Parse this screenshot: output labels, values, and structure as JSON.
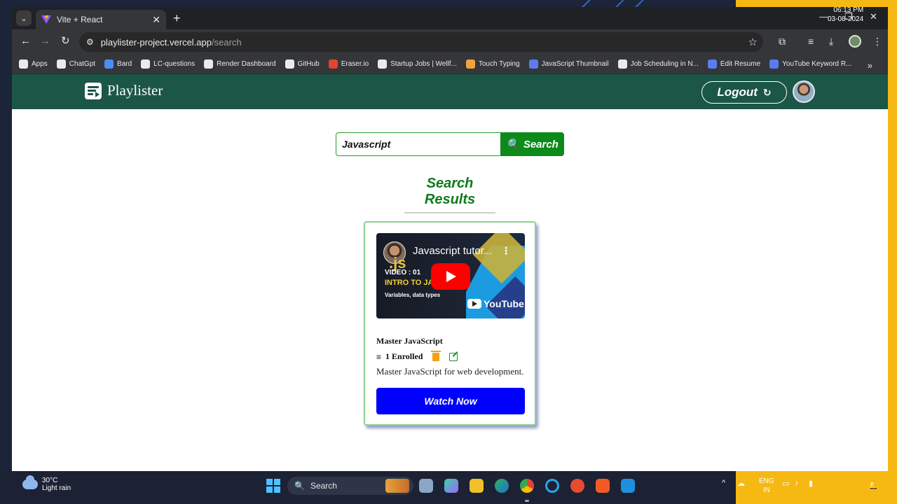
{
  "browser": {
    "tab_title": "Vite + React",
    "tab_close": "✕",
    "new_tab": "+",
    "url_host": "playlister-project.vercel.app",
    "url_path": "/search",
    "bookmarks": [
      {
        "label": "Apps",
        "color": "#e8eaed"
      },
      {
        "label": "ChatGpt",
        "color": "#e8eaed"
      },
      {
        "label": "Bard",
        "color": "#4c8df6"
      },
      {
        "label": "LC-questions",
        "color": "#e8eaed"
      },
      {
        "label": "Render Dashboard",
        "color": "#e8eaed"
      },
      {
        "label": "GitHub",
        "color": "#e8eaed"
      },
      {
        "label": "Eraser.io",
        "color": "#e0462f"
      },
      {
        "label": "Startup Jobs | Wellf...",
        "color": "#e8eaed"
      },
      {
        "label": "Touch Typing",
        "color": "#f3a23b"
      },
      {
        "label": "JavaScript Thumbnail",
        "color": "#5b7cf0"
      },
      {
        "label": "Job Scheduling in N...",
        "color": "#e8eaed"
      },
      {
        "label": "Edit Resume",
        "color": "#5b7cf0"
      },
      {
        "label": "YouTube Keyword R...",
        "color": "#5b7cf0"
      }
    ],
    "bookmarks_more": "»"
  },
  "app": {
    "brand_name": "Playlister",
    "logout_label": "Logout",
    "logout_icon": "↻",
    "search": {
      "value": "Javascript",
      "button_label": "Search",
      "button_icon": "🔍"
    },
    "results_title": "Search Results",
    "cards": [
      {
        "video_title": "Javascript tutor...",
        "video_menu": "⋮",
        "thumb_js": ".js",
        "thumb_video": "VIDEO :  01",
        "thumb_intro": "INTRO TO JA",
        "thumb_vars": "Variables, data types",
        "thumb_brand": "YouTube",
        "title": "Master JavaScript",
        "enroll_icon": "≡",
        "enrolled": "1 Enrolled",
        "description": "Master JavaScript for web development.",
        "watch_label": "Watch Now"
      }
    ]
  },
  "taskbar": {
    "temp": "30°C",
    "weather": "Light rain",
    "search_label": "Search",
    "lang_top": "ENG",
    "lang_bottom": "IN",
    "time": "06:13 PM",
    "date": "03-08-2024"
  },
  "colors": {
    "header_bg": "#1b5646",
    "search_green": "#0c8a1a",
    "watch_blue": "#0000ff",
    "results_green": "#0f7a1e"
  }
}
